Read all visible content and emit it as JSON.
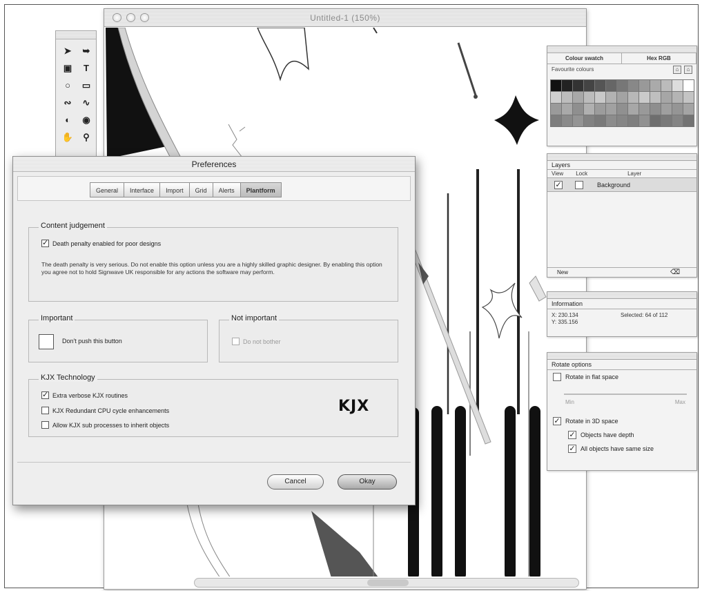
{
  "document": {
    "title": "Untitled-1 (150%)"
  },
  "tools": [
    "arrow-tool",
    "direct-select-tool",
    "frame-tool",
    "text-tool",
    "ellipse-tool",
    "rectangle-tool",
    "pen-tool",
    "curve-tool",
    "fill-tool",
    "eye-tool",
    "hand-tool",
    "zoom-tool"
  ],
  "colour_palette": {
    "tabs": [
      "Colour swatch",
      "Hex RGB"
    ],
    "favourites_label": "Favourite colours",
    "swatches": [
      "#111111",
      "#222222",
      "#333333",
      "#444444",
      "#555555",
      "#666666",
      "#777777",
      "#888888",
      "#999999",
      "#aaaaaa",
      "#bbbbbb",
      "#dddddd",
      "#ffffff",
      "#cfcfcf",
      "#bdbdbd",
      "#a8a8a8",
      "#bcbcbc",
      "#c9c9c9",
      "#b2b2b2",
      "#a3a3a3",
      "#b8b8b8",
      "#cacaca",
      "#bfbfbf",
      "#a6a6a6",
      "#b4b4b4",
      "#c4c4c4",
      "#9a9a9a",
      "#a9a9a9",
      "#8f8f8f",
      "#b0b0b0",
      "#9c9c9c",
      "#a1a1a1",
      "#909090",
      "#a7a7a7",
      "#999999",
      "#8e8e8e",
      "#9f9f9f",
      "#959595",
      "#a4a4a4",
      "#7d7d7d",
      "#8a8a8a",
      "#949494",
      "#828282",
      "#7a7a7a",
      "#8c8c8c",
      "#868686",
      "#7f7f7f",
      "#919191",
      "#6e6e6e",
      "#797979",
      "#848484",
      "#737373"
    ]
  },
  "layers_palette": {
    "title": "Layers",
    "columns": [
      "View",
      "Lock",
      "Layer"
    ],
    "layers": [
      {
        "name": "Background",
        "visible": true,
        "locked": false
      }
    ],
    "new_button": "New",
    "trash_icon": "trash-icon"
  },
  "info_palette": {
    "title": "Information",
    "x": "X: 230.134",
    "y": "Y: 335.156",
    "selected": "Selected: 64 of 112"
  },
  "rotate_palette": {
    "title": "Rotate options",
    "flat_option": "Rotate in flat space",
    "min_label": "Min",
    "max_label": "Max",
    "solid_option": "Rotate in 3D space",
    "depth_option": "Objects have depth",
    "same_size_option": "All objects have same size",
    "flat_checked": false,
    "solid_checked": true,
    "depth_checked": true,
    "same_size_checked": true
  },
  "preferences": {
    "title": "Preferences",
    "tabs": [
      "General",
      "Interface",
      "Import",
      "Grid",
      "Alerts",
      "Plantform"
    ],
    "active_tab": "Plantform",
    "content_group": {
      "label": "Content judgement",
      "checkbox": "Death penalty enabled for poor designs",
      "checked": true,
      "note": "The death penalty is very serious. Do not enable this option unless you are a highly skilled graphic designer. By enabling this option you agree not to hold Signwave UK responsible for any actions the software may perform."
    },
    "important_group": {
      "label": "Important",
      "button_text": "Don't push this button"
    },
    "not_important_group": {
      "label": "Not important",
      "checkbox": "Do not bother"
    },
    "kjx_group": {
      "label": "KJX Technology",
      "options": [
        {
          "label": "Extra verbose KJX routines",
          "checked": true
        },
        {
          "label": "KJX Redundant CPU cycle enhancements",
          "checked": false
        },
        {
          "label": "Allow KJX sub processes to inherit objects",
          "checked": false
        }
      ],
      "logo": "KJX"
    },
    "cancel_button": "Cancel",
    "okay_button": "Okay"
  }
}
